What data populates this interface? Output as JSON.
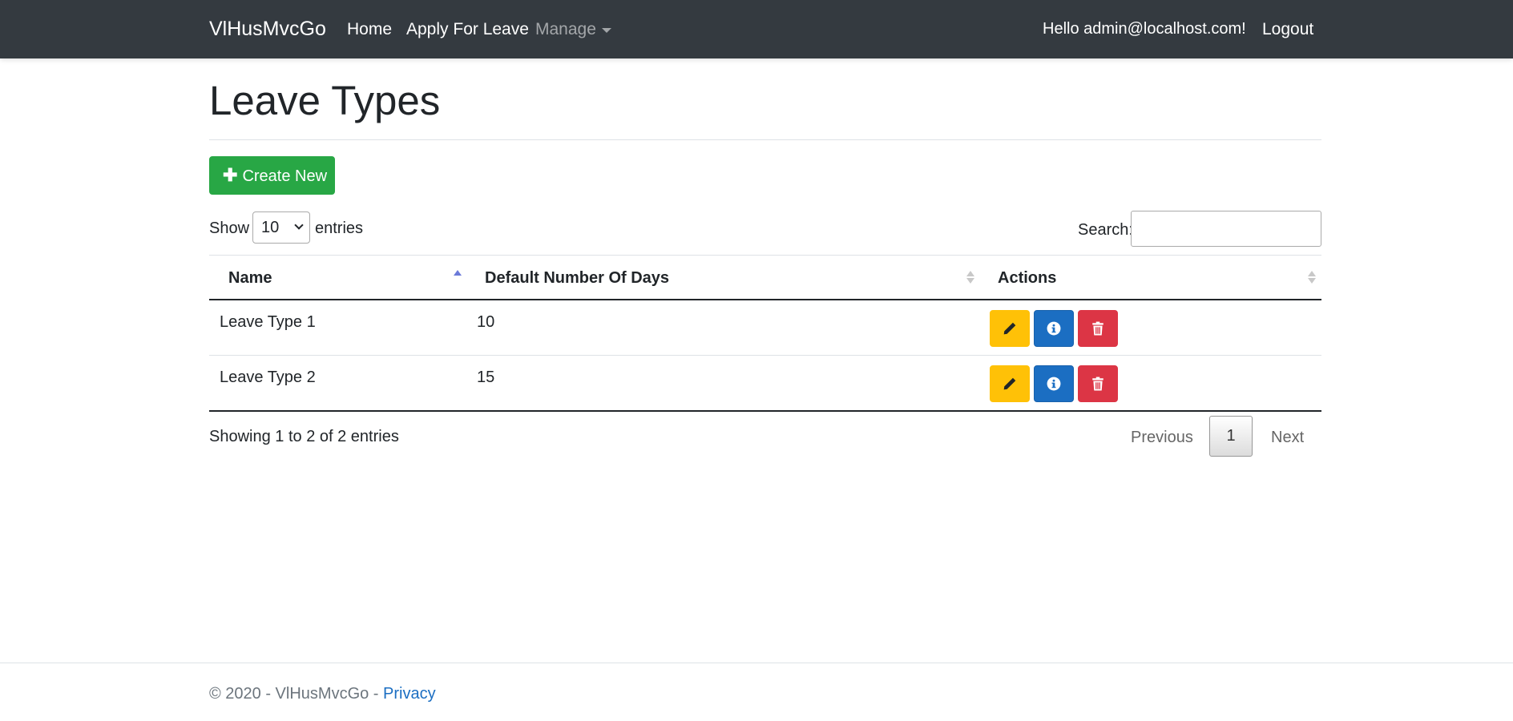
{
  "navbar": {
    "brand": "VlHusMvcGo",
    "home": "Home",
    "apply_for_leave": "Apply For Leave",
    "manage": "Manage",
    "greeting": "Hello admin@localhost.com!",
    "logout": "Logout"
  },
  "page": {
    "title": "Leave Types",
    "create_new_label": "Create New"
  },
  "table_controls": {
    "show_label": "Show",
    "page_length_value": "10",
    "entries_label": "entries",
    "search_label": "Search:",
    "search_value": ""
  },
  "table": {
    "columns": [
      "Name",
      "Default Number Of Days",
      "Actions"
    ],
    "sort": {
      "column": "Name",
      "direction": "ascending"
    },
    "rows": [
      {
        "name": "Leave Type 1",
        "days": "10"
      },
      {
        "name": "Leave Type 2",
        "days": "15"
      }
    ],
    "row_actions": [
      "pencil-icon",
      "info-icon",
      "trash-icon"
    ]
  },
  "pagination": {
    "info": "Showing 1 to 2 of 2 entries",
    "previous": "Previous",
    "current_page": "1",
    "next": "Next"
  },
  "footer": {
    "copyright": "© 2020 - VlHusMvcGo - ",
    "privacy": "Privacy"
  },
  "colors": {
    "navbar": "#343a40",
    "create_button": "#28a745",
    "edit_button": "#ffc107",
    "info_button": "#1b6ec2",
    "delete_button": "#dc3545",
    "link": "#1b6ec2"
  }
}
